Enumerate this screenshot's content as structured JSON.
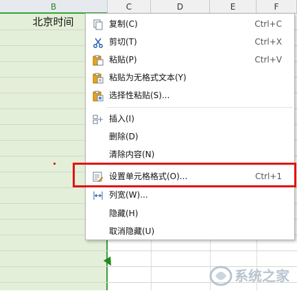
{
  "sheet": {
    "columns": [
      "B",
      "C",
      "D",
      "E",
      "F"
    ],
    "cell_b2": "北京时间"
  },
  "context_menu": {
    "items": [
      {
        "label": "复制(C)",
        "shortcut": "Ctrl+C",
        "icon": "copy-icon"
      },
      {
        "label": "剪切(T)",
        "shortcut": "Ctrl+X",
        "icon": "scissors-icon"
      },
      {
        "label": "粘贴(P)",
        "shortcut": "Ctrl+V",
        "icon": "paste-icon"
      },
      {
        "label": "粘贴为无格式文本(Y)",
        "shortcut": "",
        "icon": "paste-plain-icon"
      },
      {
        "label": "选择性粘贴(S)...",
        "shortcut": "",
        "icon": "paste-special-icon"
      },
      {
        "label": "插入(I)",
        "shortcut": "",
        "icon": "insert-icon"
      },
      {
        "label": "删除(D)",
        "shortcut": "",
        "icon": ""
      },
      {
        "label": "清除内容(N)",
        "shortcut": "",
        "icon": ""
      },
      {
        "label": "设置单元格格式(O)...",
        "shortcut": "Ctrl+1",
        "icon": "format-cells-icon"
      },
      {
        "label": "列宽(W)...",
        "shortcut": "",
        "icon": "column-width-icon"
      },
      {
        "label": "隐藏(H)",
        "shortcut": "",
        "icon": ""
      },
      {
        "label": "取消隐藏(U)",
        "shortcut": "",
        "icon": ""
      }
    ]
  },
  "watermark": {
    "text": "系统之家"
  },
  "colors": {
    "highlight": "#e01010",
    "selected_column": "#e3efd8",
    "selection_border": "#3c9a3c"
  }
}
